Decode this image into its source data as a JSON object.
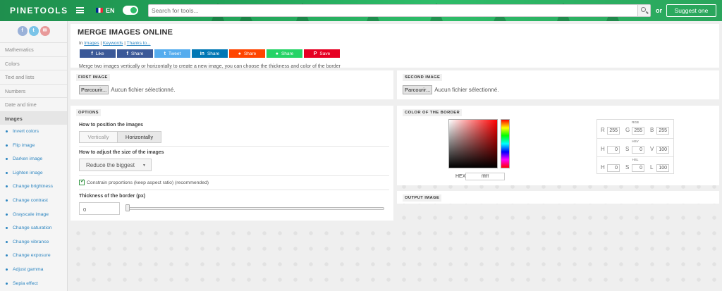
{
  "header": {
    "logo": "PINETOOLS",
    "lang": "EN",
    "search_placeholder": "Search for tools...",
    "or": "or",
    "suggest": "Suggest one"
  },
  "sidebar": {
    "social": [
      {
        "icon": "facebook-icon",
        "glyph": "f",
        "color": "#9ab1d8"
      },
      {
        "icon": "twitter-icon",
        "glyph": "t",
        "color": "#7bc4e8"
      },
      {
        "icon": "email-icon",
        "glyph": "✉",
        "color": "#e89a9a"
      }
    ],
    "categories": [
      "Mathematics",
      "Colors",
      "Text and lists",
      "Numbers",
      "Date and time",
      "Images"
    ],
    "active": "Images",
    "items": [
      "Invert colors",
      "Flip image",
      "Darken image",
      "Lighten image",
      "Change brightness",
      "Change contrast",
      "Grayscale image",
      "Change saturation",
      "Change vibrance",
      "Change exposure",
      "Adjust gamma",
      "Sepia effect"
    ]
  },
  "page": {
    "title": "MERGE IMAGES ONLINE",
    "crumb_in": "In",
    "crumb_links": [
      "Images",
      "Keywords",
      "Thanks to..."
    ],
    "shares": [
      {
        "icon": "facebook-icon",
        "glyph": "f",
        "label": "Like",
        "color": "#3b5998"
      },
      {
        "icon": "facebook-icon",
        "glyph": "f",
        "label": "Share",
        "color": "#3b5998"
      },
      {
        "icon": "twitter-icon",
        "glyph": "t",
        "label": "Tweet",
        "color": "#55acee"
      },
      {
        "icon": "linkedin-icon",
        "glyph": "in",
        "label": "Share",
        "color": "#0077b5"
      },
      {
        "icon": "reddit-icon",
        "glyph": "●",
        "label": "Share",
        "color": "#ff4500"
      },
      {
        "icon": "whatsapp-icon",
        "glyph": "●",
        "label": "Share",
        "color": "#25d366"
      },
      {
        "icon": "pinterest-icon",
        "glyph": "P",
        "label": "Save",
        "color": "#e60023"
      }
    ],
    "description": "Merge two images vertically or horizontally to create a new image, you can choose the thickness and color of the border"
  },
  "first_image": {
    "title": "FIRST IMAGE",
    "button": "Parcourir...",
    "status": "Aucun fichier sélectionné."
  },
  "second_image": {
    "title": "SECOND IMAGE",
    "button": "Parcourir...",
    "status": "Aucun fichier sélectionné."
  },
  "options": {
    "title": "OPTIONS",
    "position_label": "How to position the images",
    "position_options": [
      "Vertically",
      "Horizontally"
    ],
    "position_selected": "Horizontally",
    "size_label": "How to adjust the size of the images",
    "size_value": "Reduce the biggest",
    "constrain_label": "Constrain proportions (keep aspect ratio) (recommended)",
    "constrain_checked": true,
    "thickness_label": "Thickness of the border (px)",
    "thickness_value": "0",
    "slider_value": 0
  },
  "border_color": {
    "title": "COLOR OF THE BORDER",
    "hex_label": "HEX",
    "hex_value": "ffffff",
    "rgb": {
      "title": "RGB",
      "fields": [
        {
          "k": "R",
          "v": "255"
        },
        {
          "k": "G",
          "v": "255"
        },
        {
          "k": "B",
          "v": "255"
        }
      ]
    },
    "hsv": {
      "title": "HSV",
      "fields": [
        {
          "k": "H",
          "v": "0"
        },
        {
          "k": "S",
          "v": "0"
        },
        {
          "k": "V",
          "v": "100"
        }
      ]
    },
    "hsl": {
      "title": "HSL",
      "fields": [
        {
          "k": "H",
          "v": "0"
        },
        {
          "k": "S",
          "v": "0"
        },
        {
          "k": "L",
          "v": "100"
        }
      ]
    }
  },
  "output": {
    "title": "OUTPUT IMAGE"
  }
}
